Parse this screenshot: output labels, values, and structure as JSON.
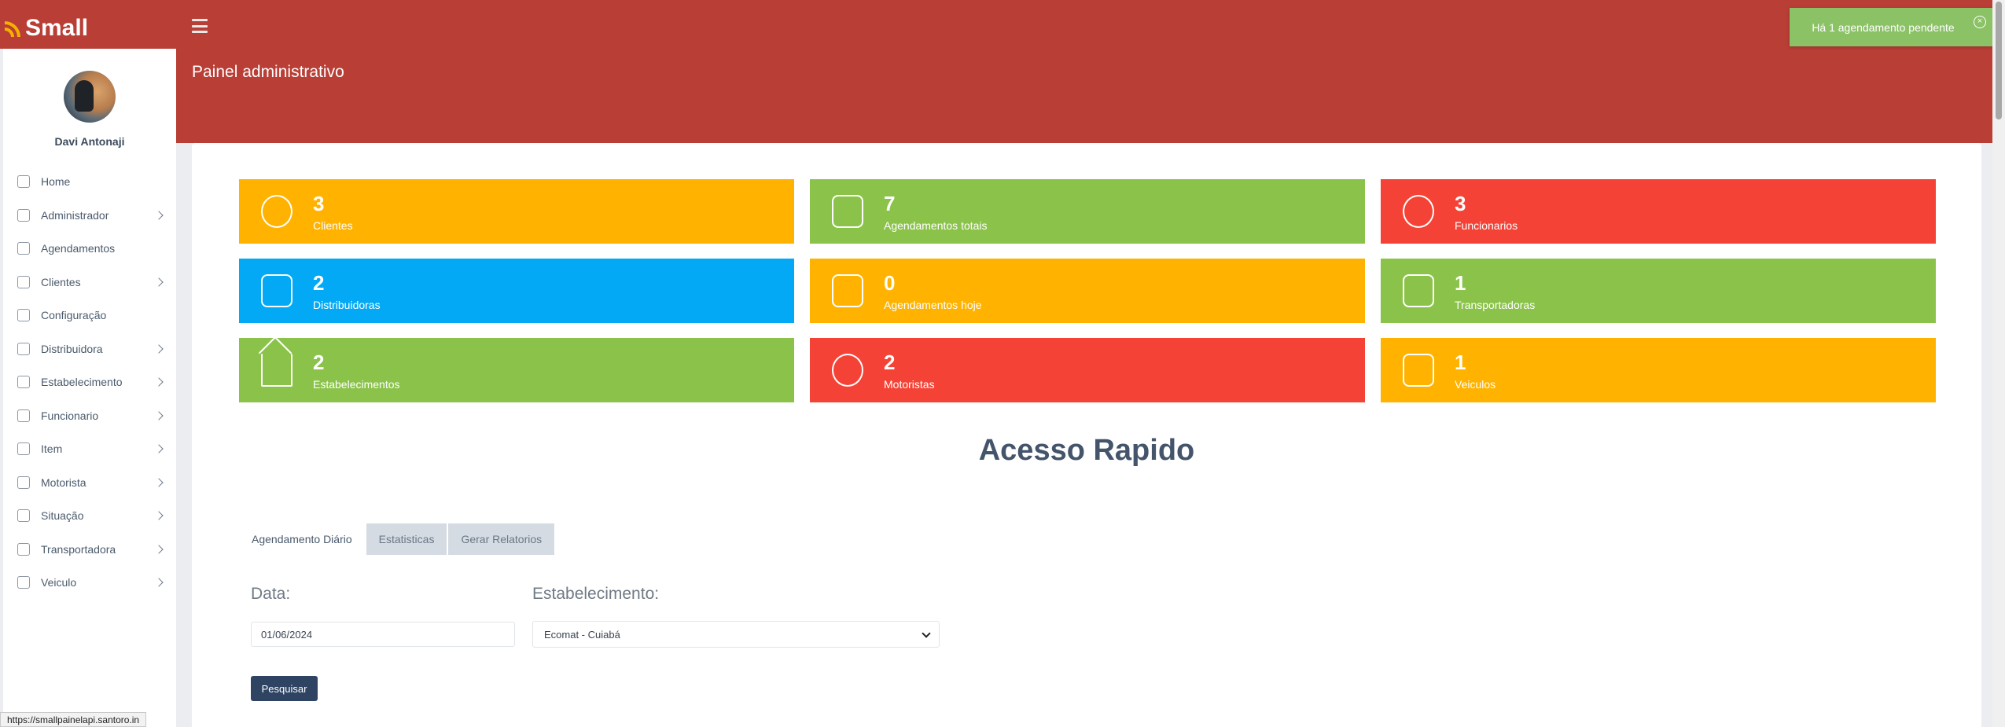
{
  "app": {
    "logo_text": "Small",
    "page_title": "Painel administrativo"
  },
  "user": {
    "name": "Davi Antonaji"
  },
  "sidebar": {
    "items": [
      {
        "label": "Home",
        "has_submenu": false
      },
      {
        "label": "Administrador",
        "has_submenu": true
      },
      {
        "label": "Agendamentos",
        "has_submenu": false
      },
      {
        "label": "Clientes",
        "has_submenu": true
      },
      {
        "label": "Configuração",
        "has_submenu": false
      },
      {
        "label": "Distribuidora",
        "has_submenu": true
      },
      {
        "label": "Estabelecimento",
        "has_submenu": true
      },
      {
        "label": "Funcionario",
        "has_submenu": true
      },
      {
        "label": "Item",
        "has_submenu": true
      },
      {
        "label": "Motorista",
        "has_submenu": true
      },
      {
        "label": "Situação",
        "has_submenu": true
      },
      {
        "label": "Transportadora",
        "has_submenu": true
      },
      {
        "label": "Veiculo",
        "has_submenu": true
      }
    ]
  },
  "colors": {
    "header_red": "#b83e36",
    "orange": "#ffb300",
    "green": "#8bc34a",
    "red": "#f44336",
    "blue": "#03a9f4",
    "toast_green": "#8bc265",
    "button_navy": "#2f4462"
  },
  "cards": [
    {
      "value": "3",
      "label": "Clientes",
      "color": "#ffb300",
      "icon": "customer-icon"
    },
    {
      "value": "7",
      "label": "Agendamentos totais",
      "color": "#8bc34a",
      "icon": "fuel-pump-icon"
    },
    {
      "value": "3",
      "label": "Funcionarios",
      "color": "#f44336",
      "icon": "employee-icon"
    },
    {
      "value": "2",
      "label": "Distribuidoras",
      "color": "#03a9f4",
      "icon": "building-icon"
    },
    {
      "value": "0",
      "label": "Agendamentos hoje",
      "color": "#ffb300",
      "icon": "fuel-pump-icon"
    },
    {
      "value": "1",
      "label": "Transportadoras",
      "color": "#8bc34a",
      "icon": "building-icon"
    },
    {
      "value": "2",
      "label": "Estabelecimentos",
      "color": "#8bc34a",
      "icon": "house-icon"
    },
    {
      "value": "2",
      "label": "Motoristas",
      "color": "#f44336",
      "icon": "driver-icon"
    },
    {
      "value": "1",
      "label": "Veiculos",
      "color": "#ffb300",
      "icon": "truck-icon"
    }
  ],
  "quick_access": {
    "title": "Acesso Rapido",
    "tabs": [
      {
        "label": "Agendamento Diário",
        "active": true
      },
      {
        "label": "Estatisticas",
        "active": false
      },
      {
        "label": "Gerar Relatorios",
        "active": false
      }
    ],
    "date_label": "Data:",
    "date_value": "01/06/2024",
    "establishment_label": "Estabelecimento:",
    "establishment_value": "Ecomat - Cuiabá",
    "search_button": "Pesquisar"
  },
  "toast": {
    "message": "Há 1 agendamento pendente",
    "close": "×"
  },
  "status_bar": {
    "url": "https://smallpainelapi.santoro.in"
  }
}
